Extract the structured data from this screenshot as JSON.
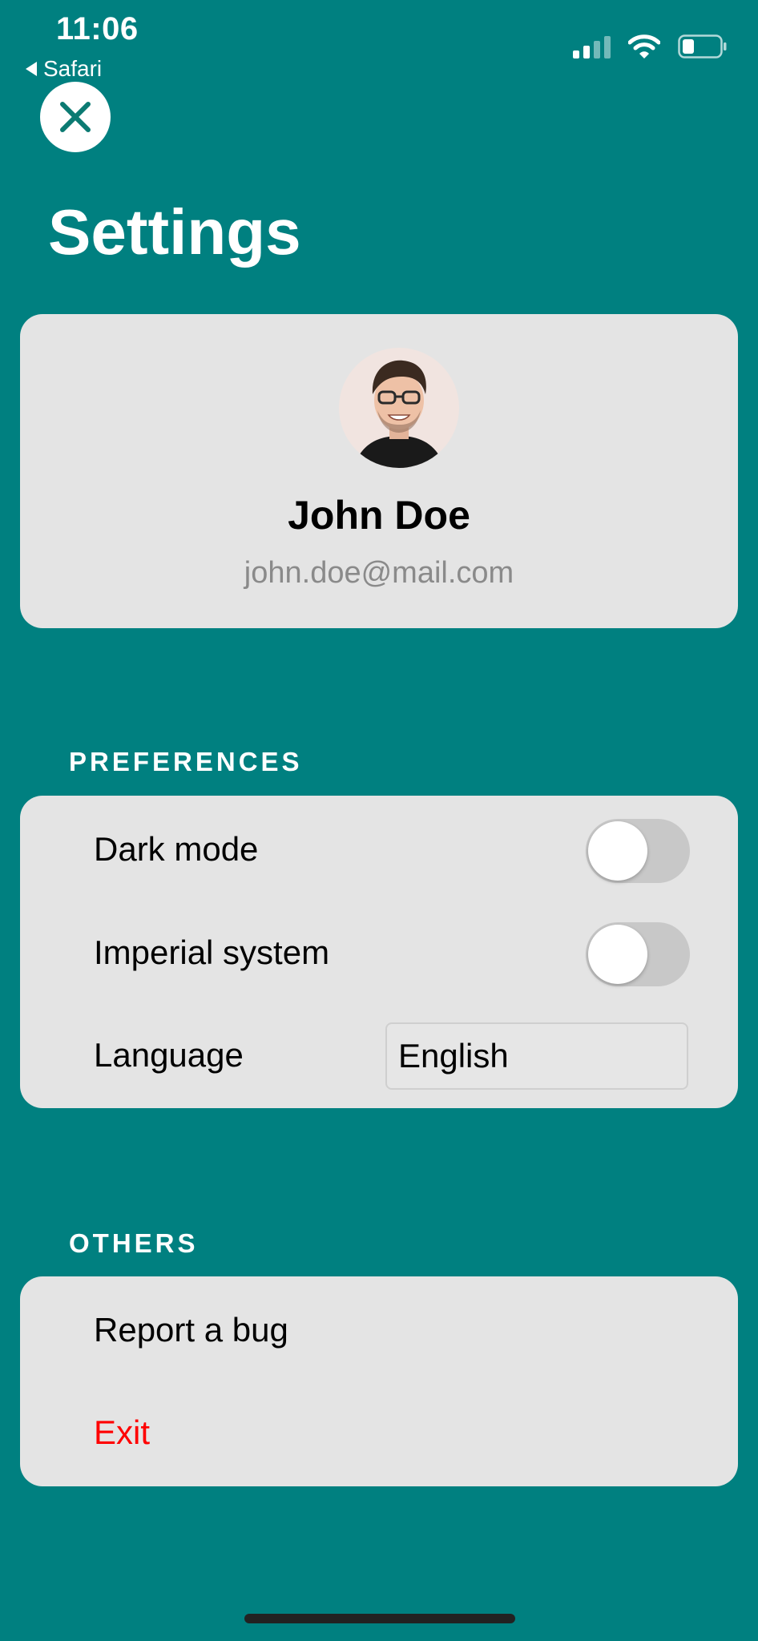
{
  "status_bar": {
    "time": "11:06",
    "back_app": "Safari",
    "icons": [
      "signal-icon",
      "wifi-icon",
      "battery-icon"
    ]
  },
  "header": {
    "close_icon": "close-icon",
    "title": "Settings"
  },
  "profile": {
    "avatar": "avatar-photo",
    "name": "John Doe",
    "email": "john.doe@mail.com"
  },
  "preferences": {
    "header": "PREFERENCES",
    "dark_mode": {
      "label": "Dark mode",
      "enabled": false
    },
    "imperial": {
      "label": "Imperial system",
      "enabled": false
    },
    "language": {
      "label": "Language",
      "value": "English"
    }
  },
  "others": {
    "header": "OTHERS",
    "report_bug": "Report a bug",
    "exit": "Exit"
  },
  "colors": {
    "background": "#008080",
    "card": "#e4e4e4",
    "exit": "#ff0000",
    "toggle_off": "#c8c8c8"
  }
}
